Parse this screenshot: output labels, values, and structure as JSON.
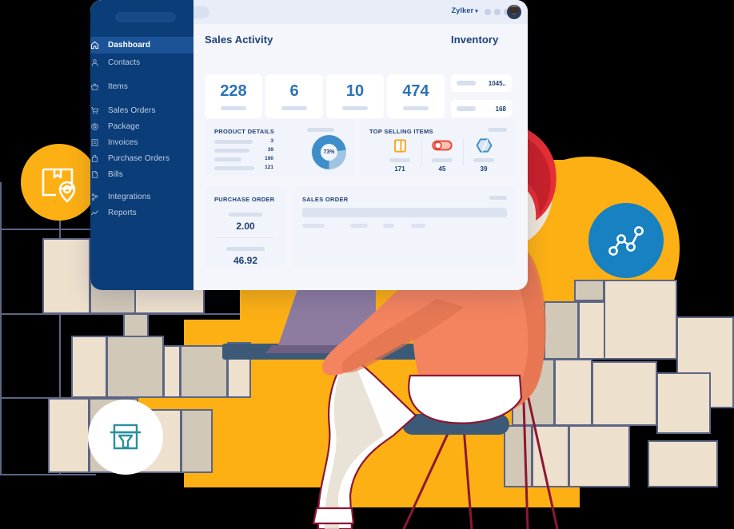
{
  "window": {
    "topbar": {
      "brand": "Zylker",
      "caret": "▾",
      "dots": [
        "dot-1",
        "dot-2",
        "dot-3"
      ],
      "traffic_dots": [
        "close",
        "minimize",
        "maximize"
      ],
      "avatar_name": "user-avatar"
    }
  },
  "sidebar": {
    "items": [
      {
        "label": "Dashboard",
        "icon": "home-icon",
        "active": true
      },
      {
        "label": "Contacts",
        "icon": "contacts-icon",
        "active": false
      },
      {
        "label": "Items",
        "icon": "basket-icon",
        "active": false
      },
      {
        "label": "Sales Orders",
        "icon": "cart-icon",
        "active": false
      },
      {
        "label": "Package",
        "icon": "package-icon",
        "active": false
      },
      {
        "label": "Invoices",
        "icon": "invoice-icon",
        "active": false
      },
      {
        "label": "Purchase Orders",
        "icon": "purchase-order-icon",
        "active": false
      },
      {
        "label": "Bills",
        "icon": "bills-icon",
        "active": false
      },
      {
        "label": "Integrations",
        "icon": "integrations-icon",
        "active": false
      },
      {
        "label": "Reports",
        "icon": "reports-icon",
        "active": false
      }
    ]
  },
  "main": {
    "sales_activity": {
      "title": "Sales Activity",
      "cards": [
        {
          "value": "228"
        },
        {
          "value": "6"
        },
        {
          "value": "10"
        },
        {
          "value": "474"
        }
      ]
    },
    "inventory": {
      "title": "Inventory",
      "rows": [
        {
          "value": "1045.."
        },
        {
          "value": "168"
        }
      ]
    },
    "product_details": {
      "title": "PRODUCT DETAILS",
      "values": [
        "3",
        "39",
        "190",
        "121"
      ],
      "donut": {
        "label": "73%",
        "percent": 73
      }
    },
    "top_selling_items": {
      "title": "TOP SELLING ITEMS",
      "items": [
        {
          "value": "171",
          "icon": "square-item-icon",
          "color": "#f5a623"
        },
        {
          "value": "45",
          "icon": "pill-item-icon",
          "color": "#ef4036"
        },
        {
          "value": "39",
          "icon": "hexagon-item-icon",
          "color": "#3d8ec9"
        }
      ]
    },
    "purchase_order": {
      "title": "PURCHASE ORDER",
      "values": [
        "2.00",
        "46.92"
      ]
    },
    "sales_order": {
      "title": "SALES ORDER"
    }
  },
  "badges": [
    {
      "name": "package-location-badge",
      "icon": "package-pin-icon",
      "color": "#fdb014"
    },
    {
      "name": "analytics-badge",
      "icon": "line-chart-icon",
      "color": "#1781c2"
    },
    {
      "name": "barcode-scanner-badge",
      "icon": "barcode-scanner-icon",
      "color": "#ffffff"
    }
  ],
  "colors": {
    "sidebar": "#0b3d78",
    "sidebar_active": "#1b5396",
    "accent_yellow": "#fdb014",
    "accent_blue": "#1781c2",
    "text_blue": "#1d3f77",
    "stat_blue": "#2c72b8",
    "carton": "#e8dcc8",
    "grid": "#5c6584",
    "skin": "#f48b5c",
    "hair": "#e42f36"
  }
}
